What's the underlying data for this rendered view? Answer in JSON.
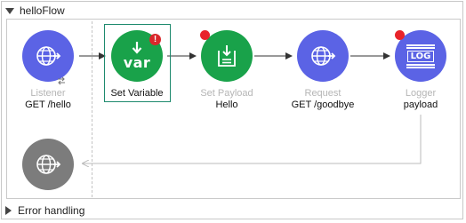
{
  "flow": {
    "name": "helloFlow",
    "error_handling_label": "Error handling"
  },
  "components": {
    "listener": {
      "type": "Listener",
      "value": "GET /hello"
    },
    "set_variable": {
      "type": "Set Variable",
      "icon_text": "var",
      "badge": "!"
    },
    "set_payload": {
      "type": "Set Payload",
      "value": "Hello"
    },
    "request": {
      "type": "Request",
      "value": "GET /goodbye"
    },
    "logger": {
      "type": "Logger",
      "value": "payload",
      "icon_text": "LOG"
    }
  },
  "colors": {
    "http_blue": "#5b63e5",
    "transformer_green": "#19a24a",
    "response_gray": "#7c7c7c",
    "selection": "#1e8a6e",
    "breakpoint_red": "#e8232a"
  }
}
